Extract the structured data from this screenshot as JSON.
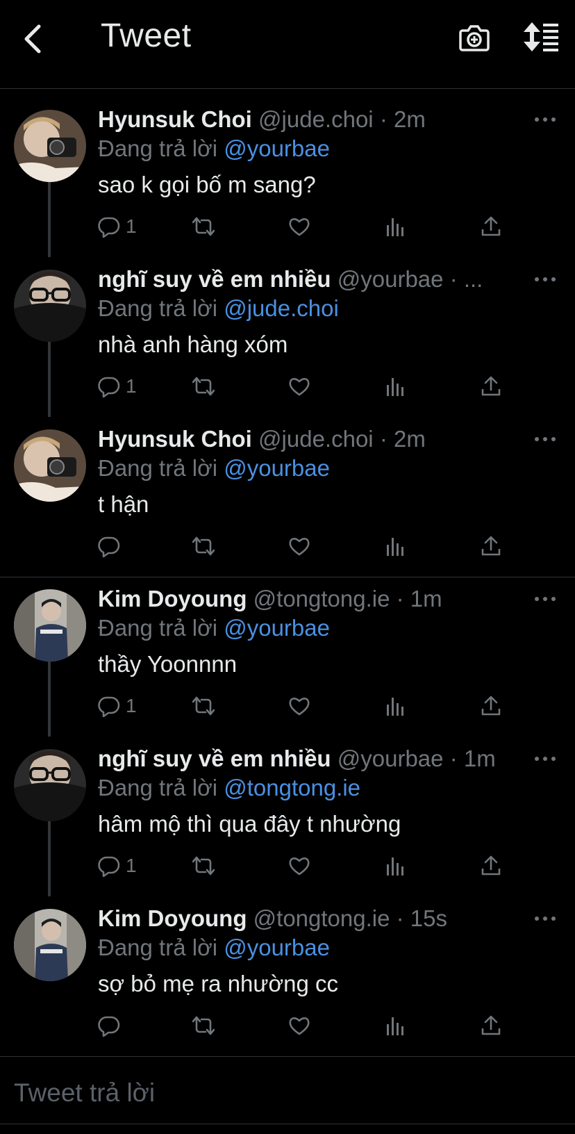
{
  "header": {
    "title": "Tweet",
    "back_icon": "chevron-left-icon",
    "camera_icon": "camera-add-icon",
    "sort_icon": "sort-list-icon"
  },
  "colors": {
    "background": "#000000",
    "text": "#e7e9ea",
    "muted": "#71767b",
    "mention": "#4a90e2",
    "divider": "#2f3336"
  },
  "tweets": [
    {
      "name": "Hyunsuk Choi",
      "handle": "@jude.choi",
      "time": "· 2m",
      "reply_prefix": "Đang trả lời",
      "reply_to": "@yourbae",
      "text": "sao k gọi bố m sang?",
      "reply_count": "1"
    },
    {
      "name": "nghĩ suy về em nhiều",
      "handle": "@yourbae",
      "time": "· ...",
      "reply_prefix": "Đang trả lời",
      "reply_to": "@jude.choi",
      "text": "nhà anh hàng xóm",
      "reply_count": "1"
    },
    {
      "name": "Hyunsuk Choi",
      "handle": "@jude.choi",
      "time": "· 2m",
      "reply_prefix": "Đang trả lời",
      "reply_to": "@yourbae",
      "text": "t hận",
      "reply_count": ""
    },
    {
      "name": "Kim Doyoung",
      "handle": "@tongtong.ie",
      "time": "· 1m",
      "reply_prefix": "Đang trả lời",
      "reply_to": "@yourbae",
      "text": "thầy Yoonnnn",
      "reply_count": "1"
    },
    {
      "name": "nghĩ suy về em nhiều",
      "handle": "@yourbae",
      "time": "· 1m",
      "reply_prefix": "Đang trả lời",
      "reply_to": "@tongtong.ie",
      "text": "hâm mộ thì qua đây t nhường",
      "reply_count": "1"
    },
    {
      "name": "Kim Doyoung",
      "handle": "@tongtong.ie",
      "time": "· 15s",
      "reply_prefix": "Đang trả lời",
      "reply_to": "@yourbae",
      "text": "sợ bỏ mẹ ra nhường cc",
      "reply_count": ""
    }
  ],
  "action_icons": [
    "reply-icon",
    "retweet-icon",
    "like-icon",
    "analytics-icon",
    "share-icon"
  ],
  "reply_box": {
    "placeholder": "Tweet trả lời"
  }
}
